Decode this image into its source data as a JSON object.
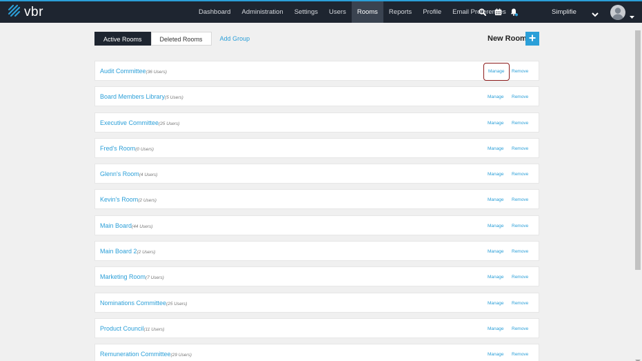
{
  "brand": {
    "logo_text": "vbr"
  },
  "nav": {
    "items": [
      {
        "label": "Dashboard",
        "active": false
      },
      {
        "label": "Administration",
        "active": false
      },
      {
        "label": "Settings",
        "active": false
      },
      {
        "label": "Users",
        "active": false
      },
      {
        "label": "Rooms",
        "active": true
      },
      {
        "label": "Reports",
        "active": false
      },
      {
        "label": "Profile",
        "active": false
      },
      {
        "label": "Email Preferences",
        "active": false
      }
    ],
    "icons": [
      "search-icon",
      "calendar-icon",
      "bell-icon"
    ],
    "user_name": "Simplifie"
  },
  "toolbar": {
    "tabs": [
      {
        "label": "Active Rooms",
        "active": true
      },
      {
        "label": "Deleted Rooms",
        "active": false
      }
    ],
    "add_group": "Add Group",
    "new_room": "New Room"
  },
  "rooms": [
    {
      "name": "Audit Committee",
      "users": "(36 Users)",
      "manage": "Manage",
      "remove": "Remove"
    },
    {
      "name": "Board Members Library",
      "users": "(5 Users)",
      "manage": "Manage",
      "remove": "Remove"
    },
    {
      "name": "Executive Committee",
      "users": "(25 Users)",
      "manage": "Manage",
      "remove": "Remove"
    },
    {
      "name": "Fred's Room",
      "users": "(0 Users)",
      "manage": "Manage",
      "remove": "Remove"
    },
    {
      "name": "Glenn's Room",
      "users": "(4 Users)",
      "manage": "Manage",
      "remove": "Remove"
    },
    {
      "name": "Kevin's Room",
      "users": "(2 Users)",
      "manage": "Manage",
      "remove": "Remove"
    },
    {
      "name": "Main Board",
      "users": "(44 Users)",
      "manage": "Manage",
      "remove": "Remove"
    },
    {
      "name": "Main Board 2",
      "users": "(2 Users)",
      "manage": "Manage",
      "remove": "Remove"
    },
    {
      "name": "Marketing Room",
      "users": "(7 Users)",
      "manage": "Manage",
      "remove": "Remove"
    },
    {
      "name": "Nominations Committee",
      "users": "(25 Users)",
      "manage": "Manage",
      "remove": "Remove"
    },
    {
      "name": "Product Council",
      "users": "(11 Users)",
      "manage": "Manage",
      "remove": "Remove"
    },
    {
      "name": "Remuneration Committee",
      "users": "(29 Users)",
      "manage": "Manage",
      "remove": "Remove"
    }
  ],
  "colors": {
    "accent": "#2b9fd8",
    "nav_bg": "#1e2530",
    "highlight_border": "#8b1a1a"
  }
}
